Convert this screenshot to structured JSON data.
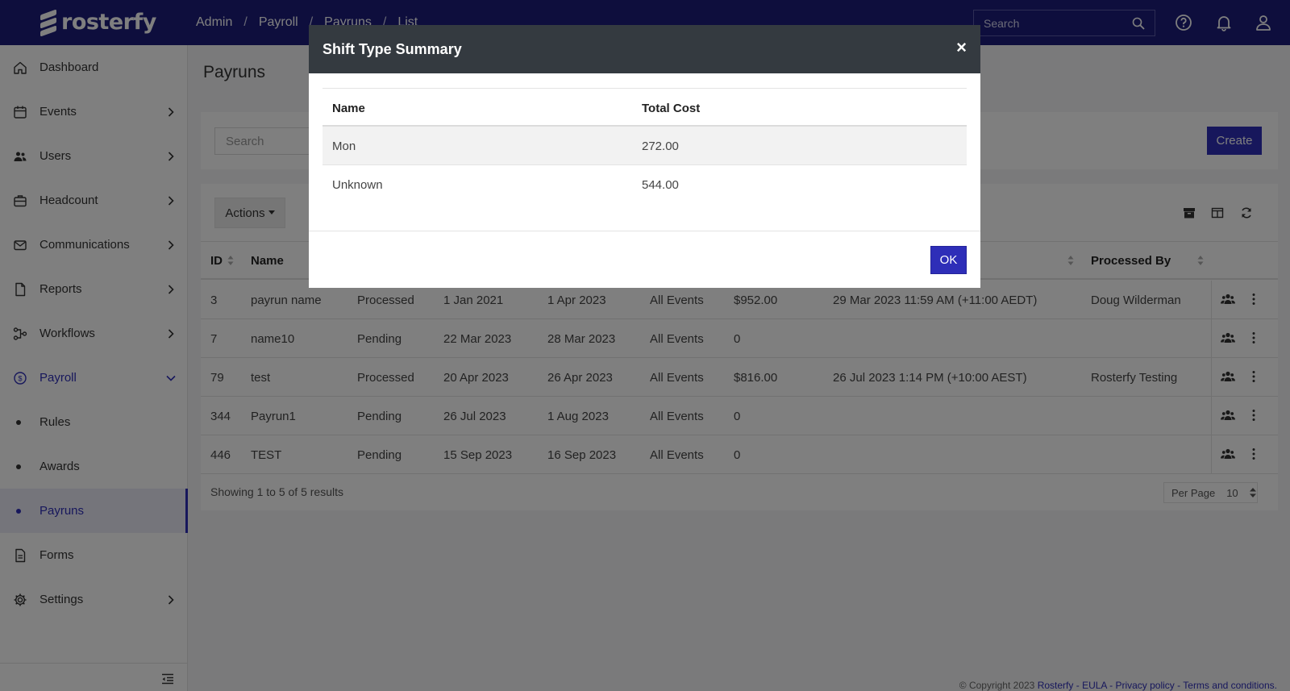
{
  "app": {
    "logo_text": "rosterfy"
  },
  "breadcrumb": [
    "Admin",
    "Payroll",
    "Payruns",
    "List"
  ],
  "top_search": {
    "placeholder": "Search"
  },
  "sidebar": {
    "items": [
      {
        "label": "Dashboard",
        "icon": "home-icon"
      },
      {
        "label": "Events",
        "icon": "calendar-icon"
      },
      {
        "label": "Users",
        "icon": "users-icon"
      },
      {
        "label": "Headcount",
        "icon": "briefcase-icon"
      },
      {
        "label": "Communications",
        "icon": "mail-icon"
      },
      {
        "label": "Reports",
        "icon": "file-icon"
      },
      {
        "label": "Workflows",
        "icon": "workflow-icon"
      },
      {
        "label": "Payroll",
        "icon": "dollar-circle-icon"
      },
      {
        "label": "Rules"
      },
      {
        "label": "Awards"
      },
      {
        "label": "Payruns"
      },
      {
        "label": "Forms",
        "icon": "form-icon"
      },
      {
        "label": "Settings",
        "icon": "gear-icon"
      }
    ]
  },
  "main": {
    "title": "Payruns",
    "search_placeholder": "Search",
    "create_label": "Create",
    "actions_label": "Actions",
    "columns": [
      "ID",
      "Name",
      "Processed By"
    ],
    "rows": [
      {
        "id": "3",
        "name": "payrun name",
        "status": "Processed",
        "start": "1 Jan 2021",
        "end": "1 Apr 2023",
        "events": "All Events",
        "cost": "$952.00",
        "processed_at": "29 Mar 2023 11:59 AM (+11:00 AEDT)",
        "processed_by": "Doug Wilderman"
      },
      {
        "id": "7",
        "name": "name10",
        "status": "Pending",
        "start": "22 Mar 2023",
        "end": "28 Mar 2023",
        "events": "All Events",
        "cost": "0",
        "processed_at": "",
        "processed_by": ""
      },
      {
        "id": "79",
        "name": "test",
        "status": "Processed",
        "start": "20 Apr 2023",
        "end": "26 Apr 2023",
        "events": "All Events",
        "cost": "$816.00",
        "processed_at": "26 Jul 2023 1:14 PM (+10:00 AEST)",
        "processed_by": "Rosterfy Testing"
      },
      {
        "id": "344",
        "name": "Payrun1",
        "status": "Pending",
        "start": "26 Jul 2023",
        "end": "1 Aug 2023",
        "events": "All Events",
        "cost": "0",
        "processed_at": "",
        "processed_by": ""
      },
      {
        "id": "446",
        "name": "TEST",
        "status": "Pending",
        "start": "15 Sep 2023",
        "end": "16 Sep 2023",
        "events": "All Events",
        "cost": "0",
        "processed_at": "",
        "processed_by": ""
      }
    ],
    "showing": "Showing 1 to 5 of 5 results",
    "per_page_label": "Per Page",
    "per_page_value": "10"
  },
  "footer": {
    "copyright": "© Copyright 2023",
    "brand": "Rosterfy",
    "links": [
      "EULA",
      "Privacy policy",
      "Terms and conditions."
    ]
  },
  "modal": {
    "title": "Shift Type Summary",
    "close": "×",
    "columns": [
      "Name",
      "Total Cost"
    ],
    "rows": [
      {
        "name": "Mon",
        "total_cost": "272.00"
      },
      {
        "name": "Unknown",
        "total_cost": "544.00"
      }
    ],
    "ok_label": "OK"
  },
  "colors": {
    "brand": "#1d1d7a",
    "accent": "#2e2eb8",
    "modal_header": "#343a40"
  }
}
